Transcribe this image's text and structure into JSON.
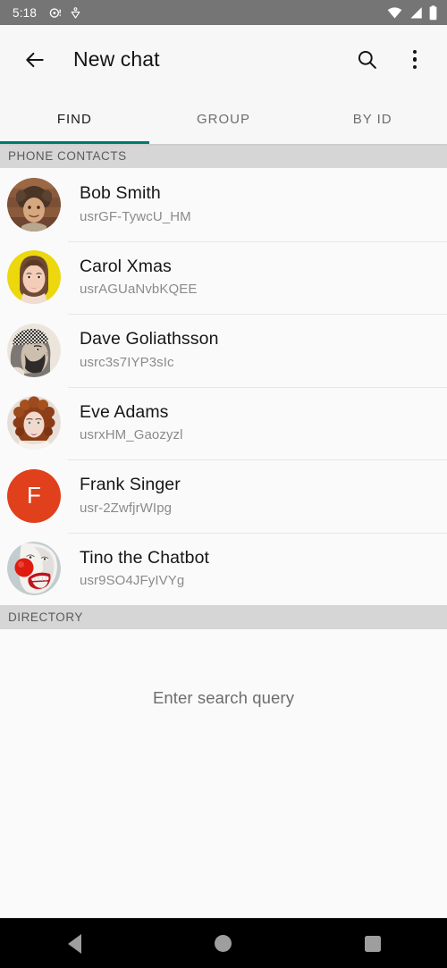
{
  "status_bar": {
    "clock": "5:18",
    "left_icons": [
      "alarm-notification-icon",
      "location-heart-icon"
    ],
    "right_icons": [
      "wifi-icon",
      "cell-signal-icon",
      "battery-icon"
    ],
    "background": "#757575"
  },
  "app_bar": {
    "back_icon": "back-arrow-icon",
    "title": "New chat",
    "search_icon": "search-icon",
    "overflow_icon": "overflow-menu-icon"
  },
  "tabs": {
    "active_index": 0,
    "accent_color": "#00796b",
    "items": [
      {
        "label": "FIND"
      },
      {
        "label": "GROUP"
      },
      {
        "label": "BY ID"
      }
    ]
  },
  "sections": [
    {
      "header": "PHONE CONTACTS",
      "contacts": [
        {
          "name": "Bob Smith",
          "user_id": "usrGF-TywcU_HM",
          "avatar": "photo-fur-hat-man",
          "avatar_type": "photo"
        },
        {
          "name": "Carol Xmas",
          "user_id": "usrAGUaNvbKQEE",
          "avatar": "photo-woman-yellow-bg",
          "avatar_type": "photo"
        },
        {
          "name": "Dave Goliathsson",
          "user_id": "usrc3s7IYP3sIc",
          "avatar": "photo-bearded-profile",
          "avatar_type": "photo"
        },
        {
          "name": "Eve Adams",
          "user_id": "usrxHM_Gaozyzl",
          "avatar": "photo-redhead-woman",
          "avatar_type": "photo"
        },
        {
          "name": "Frank Singer",
          "user_id": "usr-2ZwfjrWIpg",
          "avatar": "initial-avatar",
          "avatar_type": "initial",
          "initial": "F",
          "color": "#e0401b"
        },
        {
          "name": "Tino the Chatbot",
          "user_id": "usr9SO4JFyIVYg",
          "avatar": "photo-clown-face",
          "avatar_type": "photo"
        }
      ]
    },
    {
      "header": "DIRECTORY",
      "empty_message": "Enter search query",
      "contacts": []
    }
  ],
  "nav_bar": {
    "back": "nav-back-icon",
    "home": "nav-home-icon",
    "recents": "nav-recents-icon"
  }
}
